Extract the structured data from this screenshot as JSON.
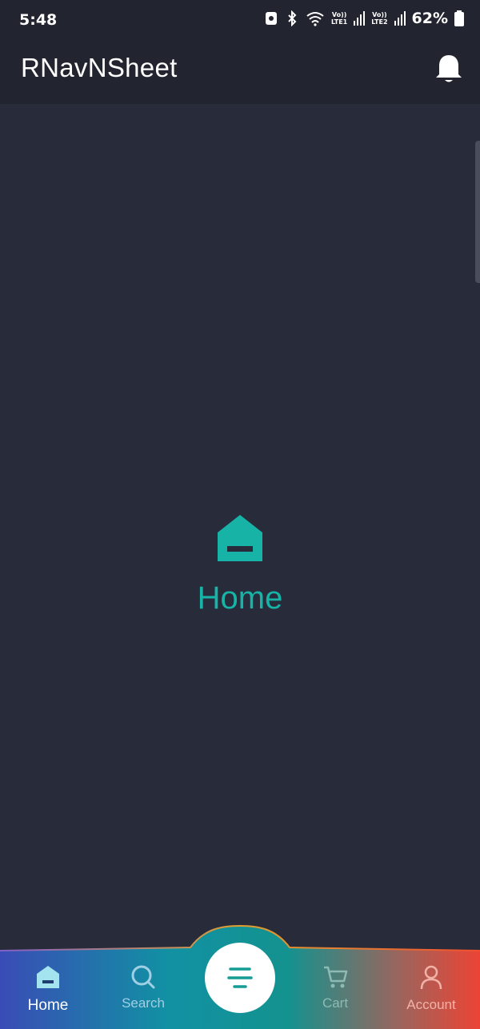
{
  "status_bar": {
    "time": "5:48",
    "lte1_top": "Vo))",
    "lte1_bottom": "LTE1",
    "lte2_top": "Vo))",
    "lte2_bottom": "LTE2",
    "battery": "62%"
  },
  "app_bar": {
    "title": "RNavNSheet",
    "notification_icon": "bell-icon"
  },
  "main": {
    "icon": "home-icon",
    "label": "Home",
    "accent": "#16b3a6"
  },
  "bottom_nav": {
    "items": [
      {
        "label": "Home",
        "icon": "home-icon",
        "active": true
      },
      {
        "label": "Search",
        "icon": "search-icon",
        "active": false
      },
      {
        "label": "Cart",
        "icon": "cart-icon",
        "active": false
      },
      {
        "label": "Account",
        "icon": "account-icon",
        "active": false
      }
    ],
    "center_button_icon": "menu-icon",
    "gradient_colors": [
      "#3d4fb4",
      "#1296a0",
      "#e8453a"
    ]
  }
}
